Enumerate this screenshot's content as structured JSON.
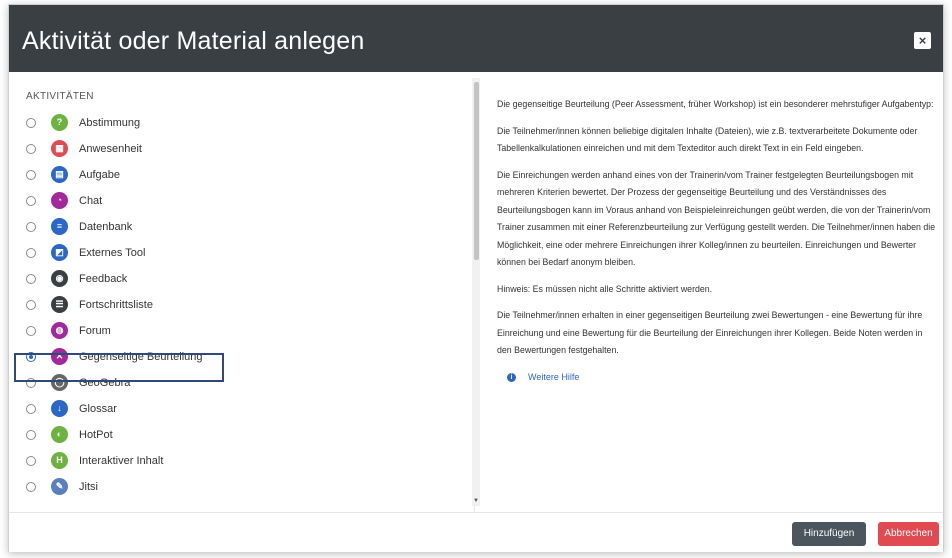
{
  "dialog": {
    "title": "Aktivität oder Material anlegen",
    "close_label": "×"
  },
  "sidebar": {
    "heading": "AKTIVITÄTEN",
    "selected_index": 9,
    "items": [
      {
        "label": "Abstimmung",
        "icon": "question-icon",
        "glyph": "?",
        "color": "#6db33f"
      },
      {
        "label": "Anwesenheit",
        "icon": "attendance-icon",
        "glyph": "▦",
        "color": "#e04a50"
      },
      {
        "label": "Aufgabe",
        "icon": "assignment-icon",
        "glyph": "▤",
        "color": "#2b66c9"
      },
      {
        "label": "Chat",
        "icon": "chat-icon",
        "glyph": "◔",
        "color": "#a3289c"
      },
      {
        "label": "Datenbank",
        "icon": "database-icon",
        "glyph": "≡",
        "color": "#2b66c9"
      },
      {
        "label": "Externes Tool",
        "icon": "puzzle-icon",
        "glyph": "◩",
        "color": "#2b66c9"
      },
      {
        "label": "Feedback",
        "icon": "feedback-icon",
        "glyph": "◉",
        "color": "#3a3f44"
      },
      {
        "label": "Fortschrittsliste",
        "icon": "checklist-icon",
        "glyph": "☰",
        "color": "#3a3f44"
      },
      {
        "label": "Forum",
        "icon": "forum-icon",
        "glyph": "◍",
        "color": "#a3289c"
      },
      {
        "label": "Gegenseitige Beurteilung",
        "icon": "workshop-icon",
        "glyph": "✕",
        "color": "#a3289c"
      },
      {
        "label": "GeoGebra",
        "icon": "geogebra-icon",
        "glyph": "◯",
        "color": "#666666"
      },
      {
        "label": "Glossar",
        "icon": "glossary-icon",
        "glyph": "↓",
        "color": "#2b66c9"
      },
      {
        "label": "HotPot",
        "icon": "hotpot-icon",
        "glyph": "◐",
        "color": "#6db33f"
      },
      {
        "label": "Interaktiver Inhalt",
        "icon": "h5p-icon",
        "glyph": "H",
        "color": "#6db33f"
      },
      {
        "label": "Jitsi",
        "icon": "jitsi-icon",
        "glyph": "✎",
        "color": "#5a7fbf"
      }
    ]
  },
  "description": {
    "paragraphs": [
      "Die gegenseitige Beurteilung (Peer Assessment, früher Workshop) ist ein besonderer mehrstufiger Aufgabentyp:",
      "Die Teilnehmer/innen können beliebige digitalen Inhalte (Dateien), wie z.B. textverarbeitete Dokumente oder Tabellenkalkulationen einreichen und mit dem Texteditor auch direkt Text in ein Feld eingeben.",
      "Die Einreichungen werden anhand eines von der Trainerin/vom Trainer festgelegten Beurteilungsbogen mit mehreren Kriterien bewertet. Der Prozess der gegenseitige Beurteilung und des Verständnisses des Beurteilungsbogen kann im Voraus anhand von Beispieleinreichungen geübt werden, die von der Trainerin/vom Trainer zusammen mit einer Referenzbeurteilung zur Verfügung gestellt werden. Die Teilnehmer/innen haben die Möglichkeit, eine oder mehrere Einreichungen ihrer Kolleg/innen zu beurteilen. Einreichungen und Bewerter können bei Bedarf anonym bleiben.",
      "Hinweis: Es müssen nicht alle Schritte aktiviert werden.",
      "Die Teilnehmer/innen erhalten in einer gegenseitigen Beurteilung zwei Bewertungen - eine Bewertung für ihre Einreichung und eine Bewertung für die Beurteilung der Einreichungen ihrer Kollegen. Beide Noten werden in den Bewertungen festgehalten."
    ],
    "help_link": "Weitere Hilfe",
    "help_icon_glyph": "i"
  },
  "footer": {
    "add_label": "Hinzufügen",
    "cancel_label": "Abbrechen"
  }
}
